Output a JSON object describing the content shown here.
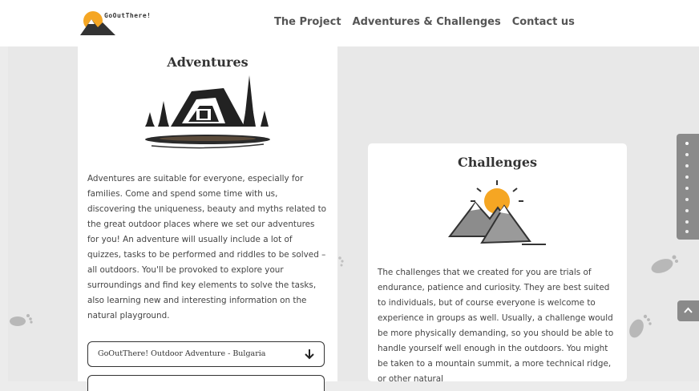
{
  "header": {
    "logo_text": "GoOutThere!",
    "nav": [
      {
        "label": "The Project"
      },
      {
        "label": "Adventures & Challenges"
      },
      {
        "label": "Contact us"
      }
    ]
  },
  "adventures": {
    "title": "Adventures",
    "text": "Adventures are suitable for everyone, especially for families. Come and spend some time with us, discovering the uniqueness, beauty and myths related to the great outdoor places where we set our adventures for you! An adventure will usually include a lot of quizzes, tasks to be performed and riddles to be solved – all outdoors. You'll be provoked to explore your surroundings and find key elements to solve the tasks, also learning new and interesting information on the natural playground.",
    "dropdown_label": "GoOutThere! Outdoor Adventure - Bulgaria"
  },
  "challenges": {
    "title": "Challenges",
    "text": "The challenges that we created for you are trials of endurance, patience and curiosity. They are best suited to individuals, but of course everyone is welcome to experience in groups as well. Usually, a challenge would be more physically demanding, so you should be able to handle yourself well enough in the outdoors. You might be taken to a mountain summit, a more technical ridge, or other natural"
  },
  "colors": {
    "accent": "#f5a623",
    "text": "#444444",
    "panel": "#8a8a8a"
  }
}
